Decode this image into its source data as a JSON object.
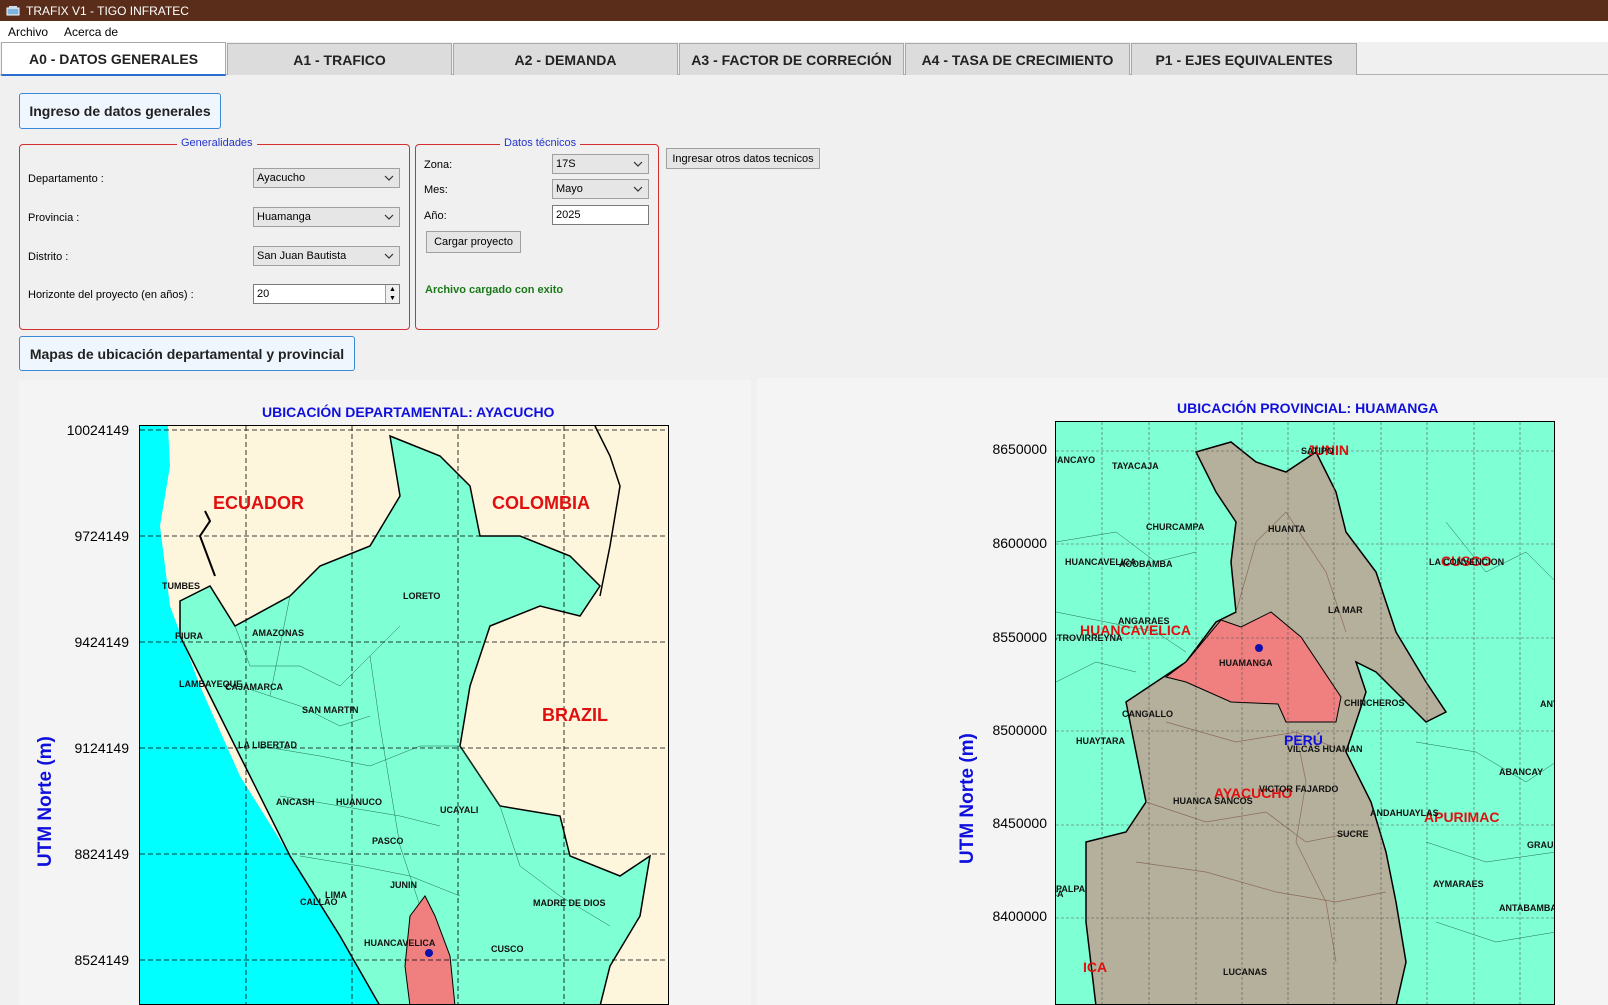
{
  "window": {
    "title": "TRAFIX V1 - TIGO INFRATEC"
  },
  "menu": {
    "items": [
      "Archivo",
      "Acerca de"
    ]
  },
  "tabs": [
    {
      "label": "A0 - DATOS GENERALES"
    },
    {
      "label": "A1 - TRAFICO"
    },
    {
      "label": "A2 - DEMANDA"
    },
    {
      "label": "A3 - FACTOR DE CORRECIÓN"
    },
    {
      "label": "A4 - TASA DE CRECIMIENTO"
    },
    {
      "label": "P1 - EJES EQUIVALENTES"
    }
  ],
  "general": {
    "header_button": "Ingreso de datos generales",
    "group_title": "Generalidades",
    "departamento_label": "Departamento :",
    "departamento_value": "Ayacucho",
    "provincia_label": "Provincia :",
    "provincia_value": "Huamanga",
    "distrito_label": "Distrito :",
    "distrito_value": "San Juan Bautista",
    "horizonte_label": "Horizonte del proyecto (en años) :",
    "horizonte_value": "20"
  },
  "tecnicos": {
    "group_title": "Datos técnicos",
    "zona_label": "Zona:",
    "zona_value": "17S",
    "mes_label": "Mes:",
    "mes_value": "Mayo",
    "anio_label": "Año:",
    "anio_value": "2025",
    "cargar_button": "Cargar proyecto",
    "status": "Archivo cargado con exito",
    "otros_button": "Ingresar otros datos tecnicos"
  },
  "maps": {
    "header_button": "Mapas de ubicación departamental y provincial",
    "departamental": {
      "title": "UBICACIÓN DEPARTAMENTAL: AYACUCHO",
      "ylabel": "UTM Norte (m)",
      "yticks": [
        "10024149",
        "9724149",
        "9424149",
        "9124149",
        "8824149",
        "8524149"
      ],
      "countries": [
        "ECUADOR",
        "COLOMBIA",
        "BRAZIL"
      ],
      "places": [
        "TUMBES",
        "PIURA",
        "AMAZONAS",
        "LORETO",
        "LAMBAYEQUE",
        "CAJAMARCA",
        "SAN MARTIN",
        "LA LIBERTAD",
        "ANCASH",
        "HUANUCO",
        "UCAYALI",
        "PASCO",
        "JUNIN",
        "LIMA",
        "CALLAO",
        "MADRE DE DIOS",
        "HUANCAVELICA",
        "CUSCO"
      ]
    },
    "provincial": {
      "title": "UBICACIÓN PROVINCIAL: HUAMANGA",
      "ylabel": "UTM Norte (m)",
      "yticks": [
        "8650000",
        "8600000",
        "8550000",
        "8500000",
        "8450000",
        "8400000"
      ],
      "regions": [
        "JUNIN",
        "CUSCO",
        "HUANCAVELICA",
        "AYACUCHO",
        "APURIMAC",
        "ICA"
      ],
      "peru": "PERÚ",
      "places": [
        "HUANCAYO",
        "TAYACAJA",
        "SATIPO",
        "CHURCAMPA",
        "HUANTA",
        "HUANCAVELICA",
        "ACOBAMBA",
        "LA CONVENCION",
        "LA MAR",
        "ANGARAES",
        "CASTROVIRREYNA",
        "HUAMANGA",
        "CHINCHEROS",
        "ANTA",
        "CANGALLO",
        "HUAYTARA",
        "VILCAS HUAMAN",
        "ABANCAY",
        "VICTOR FAJARDO",
        "HUANCA SANCOS",
        "ANDAHUAYLAS",
        "SUCRE",
        "GRAU",
        "PALPA",
        "ICA",
        "AYMARAES",
        "ANTABAMBA",
        "LUCANAS"
      ]
    }
  }
}
